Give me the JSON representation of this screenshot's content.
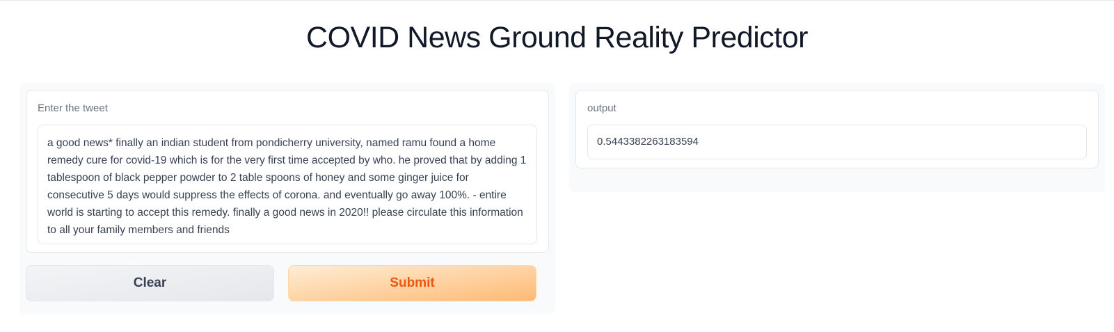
{
  "app": {
    "title": "COVID News Ground Reality Predictor"
  },
  "input": {
    "label": "Enter the tweet",
    "value": "a good news* finally an indian student from pondicherry university, named ramu found a home remedy cure for covid-19 which is for the very first time accepted by who. he proved that by adding 1 tablespoon of black pepper powder to 2 table spoons of honey and some ginger juice for consecutive 5 days would suppress the effects of corona. and eventually go away 100%. - entire world is starting to accept this remedy. finally a good news in 2020!! please circulate this information to all your family members and friends"
  },
  "output": {
    "label": "output",
    "value": "0.5443382263183594"
  },
  "buttons": {
    "clear_label": "Clear",
    "submit_label": "Submit"
  },
  "colors": {
    "submit_text": "#ea580c",
    "submit_bg_start": "#ffedd5",
    "submit_bg_end": "#fdba74",
    "panel_bg": "#f9fafb"
  }
}
